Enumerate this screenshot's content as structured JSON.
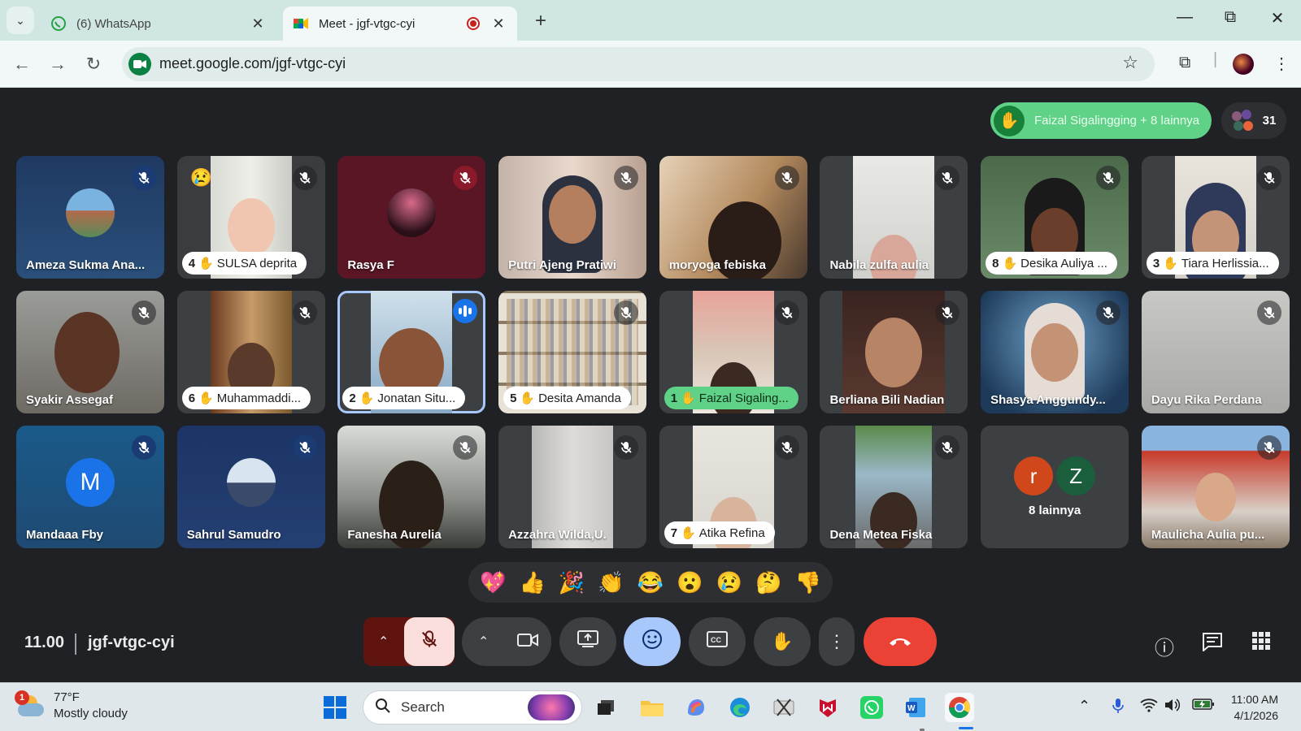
{
  "browser": {
    "tabs": [
      {
        "title": "(6) WhatsApp",
        "icon": "whatsapp-icon"
      },
      {
        "title": "Meet - jgf-vtgc-cyi",
        "icon": "google-meet-icon"
      }
    ],
    "url": "meet.google.com/jgf-vtgc-cyi"
  },
  "meet": {
    "raised_hands_text": "Faizal Sigalingging + 8 lainnya",
    "participant_count": "31",
    "participants": [
      {
        "name": "Ameza Sukma Ana...",
        "mic": "muted"
      },
      {
        "name": "SULSA deprita",
        "hand": "4",
        "mic": "muted",
        "reaction": "😢"
      },
      {
        "name": "Rasya F",
        "mic": "muted"
      },
      {
        "name": "Putri Ajeng Pratiwi",
        "mic": "muted"
      },
      {
        "name": "moryoga febiska",
        "mic": "muted"
      },
      {
        "name": "Nabila zulfa aulia",
        "mic": "muted"
      },
      {
        "name": "Desika Auliya ...",
        "hand": "8",
        "mic": "muted"
      },
      {
        "name": "Tiara Herlissia...",
        "hand": "3",
        "mic": "muted"
      },
      {
        "name": "Syakir Assegaf",
        "mic": "muted"
      },
      {
        "name": "Muhammaddi...",
        "hand": "6",
        "mic": "muted"
      },
      {
        "name": "Jonatan Situ...",
        "hand": "2",
        "mic": "speaking"
      },
      {
        "name": "Desita Amanda",
        "hand": "5",
        "mic": "muted"
      },
      {
        "name": "Faizal Sigaling...",
        "hand": "1",
        "mic": "muted"
      },
      {
        "name": "Berliana Bili Nadian",
        "mic": "muted"
      },
      {
        "name": "Shasya Anggundy...",
        "mic": "muted"
      },
      {
        "name": "Dayu Rika Perdana",
        "mic": "muted"
      },
      {
        "name": "Mandaaa Fby",
        "mic": "muted",
        "initial": "M"
      },
      {
        "name": "Sahrul Samudro",
        "mic": "muted"
      },
      {
        "name": "Fanesha Aurelia",
        "mic": "muted"
      },
      {
        "name": "Azzahra Wilda,U.",
        "mic": "muted"
      },
      {
        "name": "Atika Refina",
        "hand": "7",
        "mic": "muted"
      },
      {
        "name": "Dena Metea Fiska",
        "mic": "muted"
      },
      {
        "name": "8 lainnya",
        "initials": [
          "r",
          "Z"
        ]
      },
      {
        "name": "Maulicha Aulia pu...",
        "mic": "muted"
      }
    ],
    "reactions": [
      "💖",
      "👍",
      "🎉",
      "👏",
      "😂",
      "😮",
      "😢",
      "🤔",
      "👎"
    ],
    "time": "11.00",
    "meeting_code": "jgf-vtgc-cyi"
  },
  "taskbar": {
    "weather_temp": "77°F",
    "weather_desc": "Mostly cloudy",
    "weather_badge": "1",
    "search_label": "Search",
    "time": "11:00 AM",
    "date": "4/1/2026"
  },
  "colors": {
    "accent": "#1a73e8",
    "hand_green": "#5fd287",
    "end_call": "#ea4335",
    "mic_off_red": "#8c1d18"
  }
}
